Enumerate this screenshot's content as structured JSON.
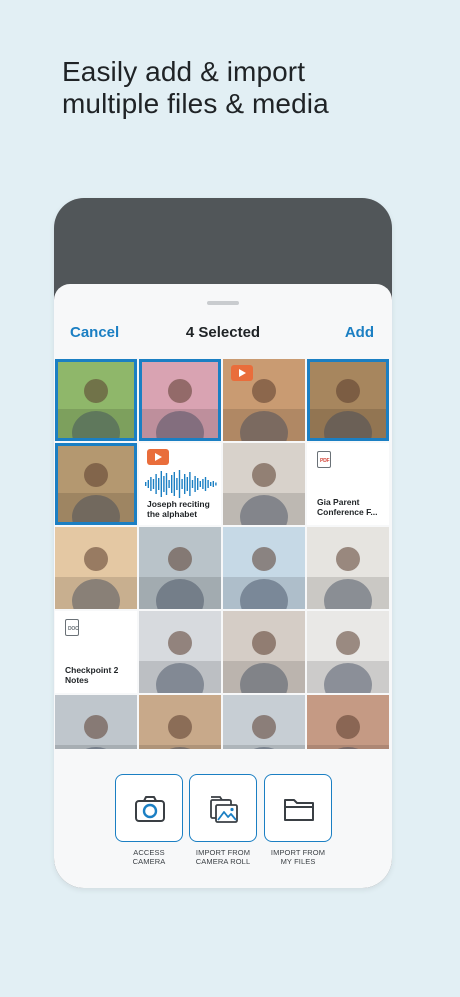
{
  "headline": {
    "line1": "Easily add & import",
    "line2": "multiple files & media"
  },
  "navbar": {
    "cancel": "Cancel",
    "title": "4 Selected",
    "add": "Add"
  },
  "tiles": [
    {
      "kind": "photo",
      "selected": true,
      "bg": "#8fb76a"
    },
    {
      "kind": "photo",
      "selected": true,
      "bg": "#d9a3b2"
    },
    {
      "kind": "video",
      "selected": false,
      "bg": "#c99b72"
    },
    {
      "kind": "photo",
      "selected": true,
      "bg": "#a7865e"
    },
    {
      "kind": "photo",
      "selected": true,
      "bg": "#b49870"
    },
    {
      "kind": "audio",
      "label": "Joseph reciting the alphabet"
    },
    {
      "kind": "photo",
      "selected": false,
      "bg": "#d8d2cb"
    },
    {
      "kind": "document",
      "filetype": "PDF",
      "label": "Gia Parent Conference F..."
    },
    {
      "kind": "photo",
      "selected": false,
      "bg": "#e4c8a3"
    },
    {
      "kind": "photo",
      "selected": false,
      "bg": "#b9c3c9"
    },
    {
      "kind": "photo",
      "selected": false,
      "bg": "#c6d9e6"
    },
    {
      "kind": "photo",
      "selected": false,
      "bg": "#e6e4e0"
    },
    {
      "kind": "document",
      "filetype": "DOC",
      "label": "Checkpoint 2 Notes"
    },
    {
      "kind": "photo",
      "selected": false,
      "bg": "#d7dade"
    },
    {
      "kind": "photo",
      "selected": false,
      "bg": "#d5cdc6"
    },
    {
      "kind": "photo",
      "selected": false,
      "bg": "#e9e8e6"
    },
    {
      "kind": "photo",
      "selected": false,
      "bg": "#bfc6cc"
    },
    {
      "kind": "photo",
      "selected": false,
      "bg": "#c8a98a"
    },
    {
      "kind": "photo",
      "selected": false,
      "bg": "#c7ced4"
    },
    {
      "kind": "photo",
      "selected": false,
      "bg": "#c59a84"
    }
  ],
  "actions": [
    {
      "icon": "camera-icon",
      "line1": "ACCESS",
      "line2": "CAMERA"
    },
    {
      "icon": "photo-library-icon",
      "line1": "IMPORT FROM",
      "line2": "CAMERA ROLL"
    },
    {
      "icon": "folder-icon",
      "line1": "IMPORT FROM",
      "line2": "MY FILES"
    }
  ],
  "colors": {
    "accent": "#1b7fc3",
    "background": "#e2eff4",
    "phone_frame": "#515659",
    "video_badge": "#e96d3b"
  }
}
